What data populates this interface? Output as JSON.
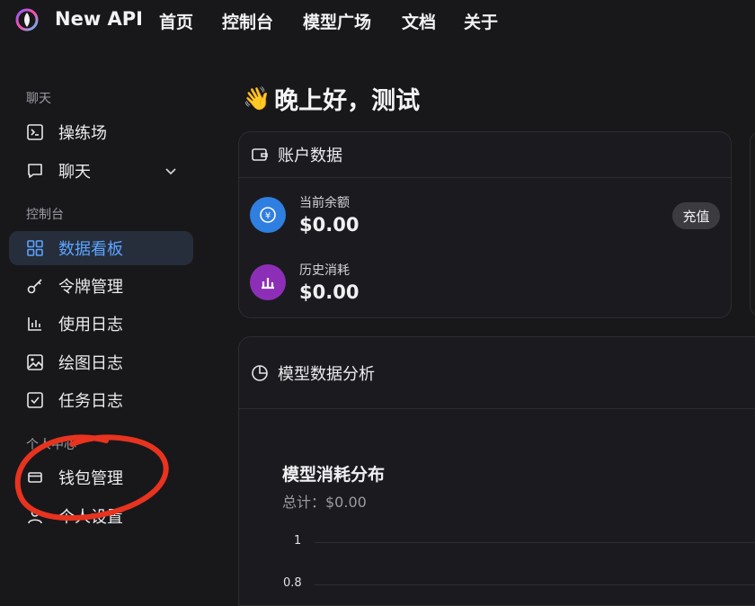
{
  "header": {
    "brand": "New API",
    "nav": [
      {
        "label": "首页"
      },
      {
        "label": "控制台"
      },
      {
        "label": "模型广场"
      },
      {
        "label": "文档"
      },
      {
        "label": "关于"
      }
    ]
  },
  "sidebar": {
    "groups": [
      {
        "label": "聊天"
      },
      {
        "label": "控制台"
      },
      {
        "label": "个人中心"
      }
    ],
    "items": [
      {
        "label": "操练场",
        "icon": "terminal-icon"
      },
      {
        "label": "聊天",
        "icon": "chat-icon"
      },
      {
        "label": "数据看板",
        "icon": "dashboard-grid-icon"
      },
      {
        "label": "令牌管理",
        "icon": "key-icon"
      },
      {
        "label": "使用日志",
        "icon": "bar-chart-icon"
      },
      {
        "label": "绘图日志",
        "icon": "image-icon"
      },
      {
        "label": "任务日志",
        "icon": "checkbox-icon"
      },
      {
        "label": "钱包管理",
        "icon": "wallet-icon"
      },
      {
        "label": "个人设置",
        "icon": "user-icon"
      }
    ],
    "active_item": "数据看板"
  },
  "main": {
    "greeting": "晚上好，测试",
    "greeting_emoji": "👋",
    "account_card": {
      "title": "账户数据",
      "balance_label": "当前余额",
      "balance_value": "$0.00",
      "history_label": "历史消耗",
      "history_value": "$0.00",
      "recharge_label": "充值"
    },
    "analysis_card": {
      "title": "模型数据分析",
      "chart_title": "模型消耗分布",
      "chart_total": "总计：$0.00"
    }
  },
  "chart_data": {
    "type": "bar",
    "title": "模型消耗分布",
    "y_ticks": [
      "1",
      "0.8"
    ],
    "ylim": [
      0,
      1
    ],
    "categories": [],
    "values": []
  },
  "colors": {
    "accent": "#5aa4ff",
    "balance_icon_bg": "#2f7fe0",
    "history_icon_bg": "#8d2fb6",
    "annotation": "#e8331f"
  }
}
